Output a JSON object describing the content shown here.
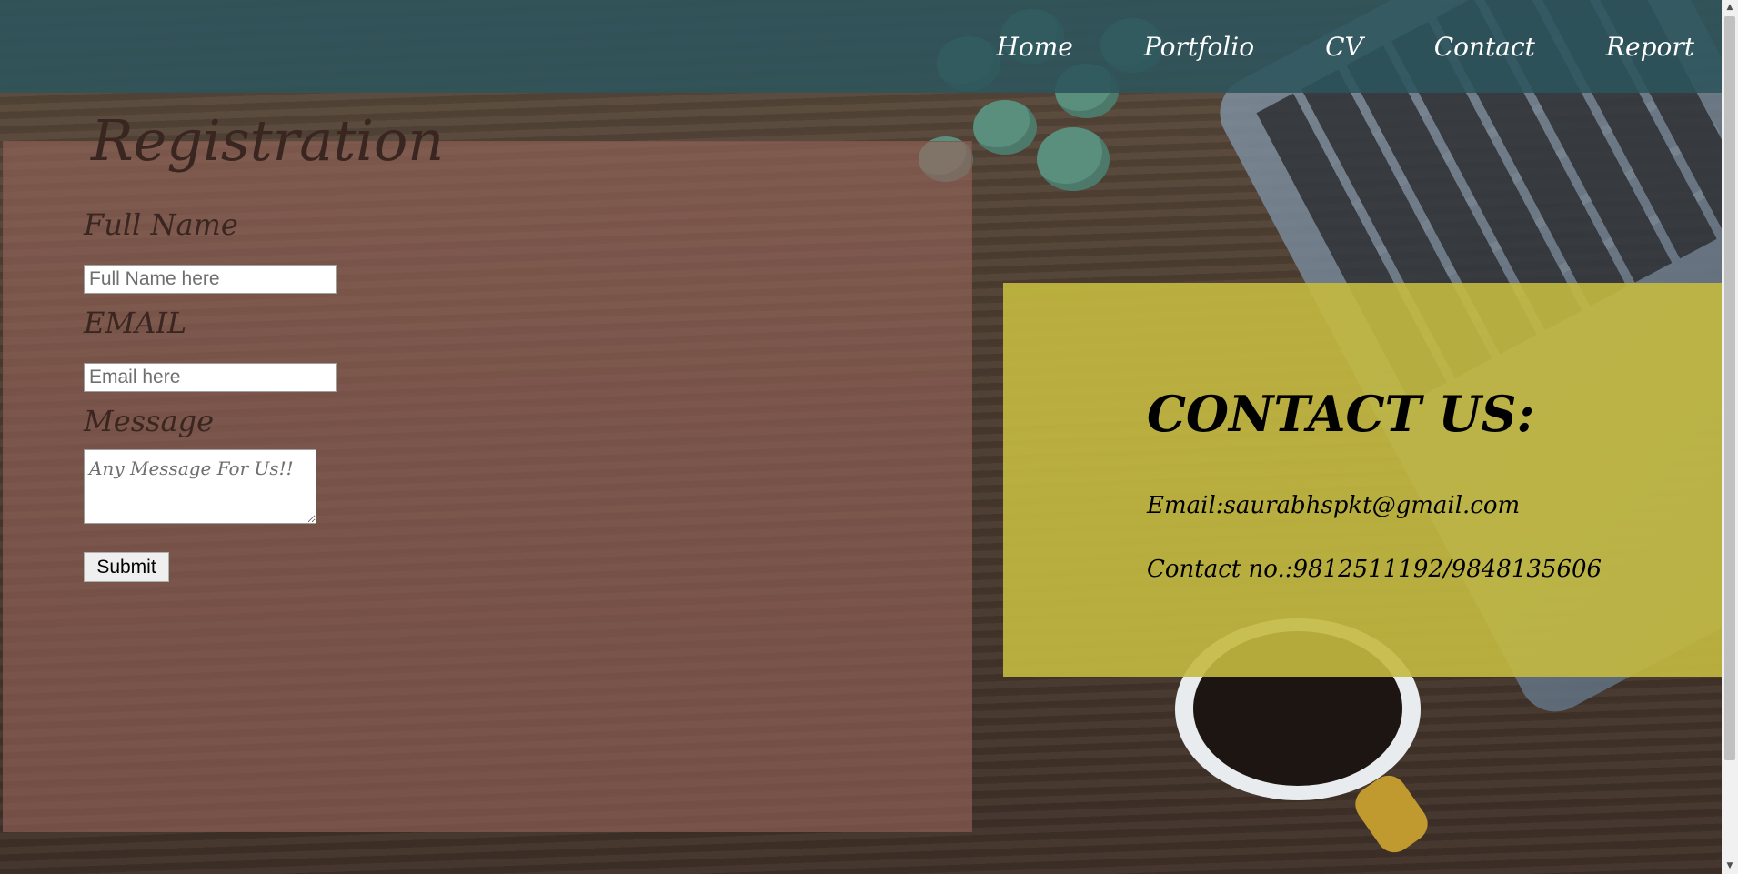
{
  "nav": {
    "items": [
      {
        "label": "Home"
      },
      {
        "label": "Portfolio"
      },
      {
        "label": "CV"
      },
      {
        "label": "Contact"
      },
      {
        "label": "Report"
      }
    ]
  },
  "registration": {
    "title": "Registration",
    "full_name_label": "Full Name",
    "full_name_placeholder": "Full Name here",
    "email_label": "EMAIL",
    "email_placeholder": "Email here",
    "message_label": "Message",
    "message_placeholder": "Any Message For Us!!",
    "submit_label": "Submit"
  },
  "contact": {
    "title": "CONTACT US:",
    "email_line": "Email:saurabhspkt@gmail.com",
    "phone_line": "Contact no.:9812511192/9848135606"
  },
  "colors": {
    "header_bg": "#2c545c",
    "registration_panel": "#96645a",
    "contact_panel": "#c4ba40"
  }
}
